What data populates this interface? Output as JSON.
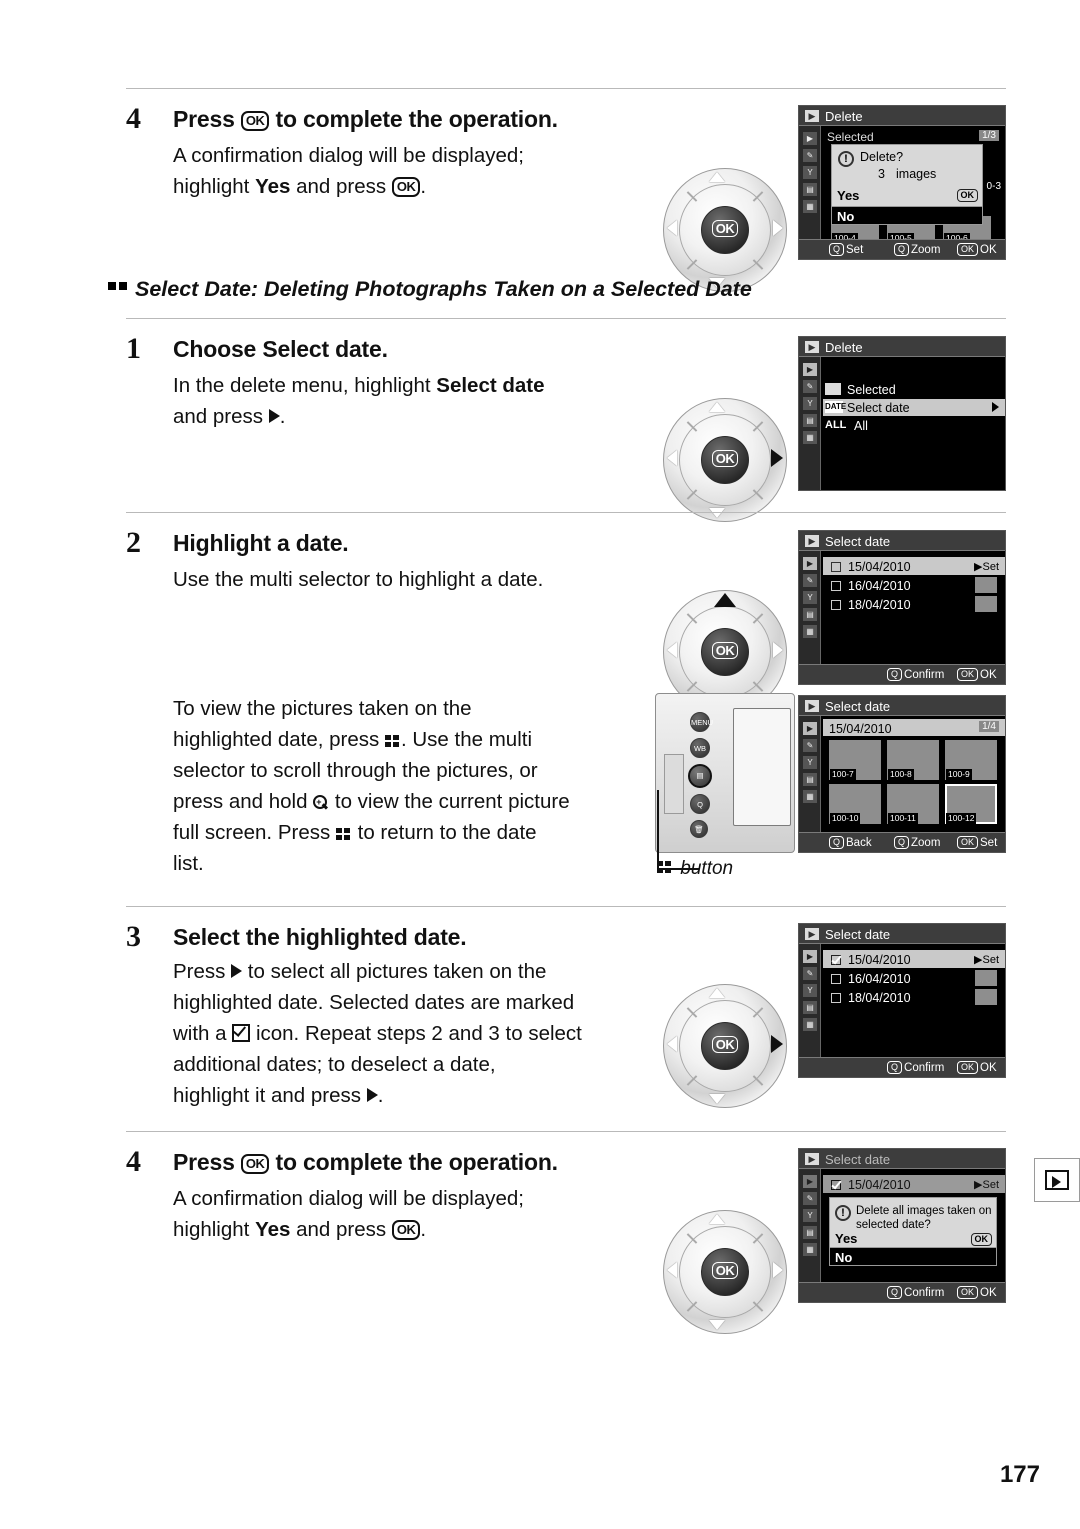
{
  "page": {
    "number": "177"
  },
  "section": {
    "heading": "Select Date: Deleting Photographs Taken on a Selected Date"
  },
  "steps": [
    {
      "num": "4",
      "title_pre": "Press ",
      "title_post": " to complete the operation.",
      "body_l1": "A confirmation dialog will be displayed;",
      "body_l2_pre": "highlight ",
      "body_l2_bold": "Yes",
      "body_l2_post": " and press "
    },
    {
      "num": "1",
      "title_pre": "Choose ",
      "title_bold": "Select date",
      "title_post": ".",
      "body_l1_pre": "In the delete menu, highlight ",
      "body_l1_bold": "Select date",
      "body_l2": "and press"
    },
    {
      "num": "2",
      "title": "Highlight a date.",
      "body": "Use the multi selector to highlight a date.",
      "para2": [
        "To view the pictures taken on the",
        "highlighted date, press      .  Use the multi",
        "selector to scroll through the pictures, or",
        "press and hold      to view the current picture",
        "full screen.  Press      to return to the date",
        "list."
      ]
    },
    {
      "num": "3",
      "title": "Select the highlighted date.",
      "para": [
        "Press      to select all pictures taken on the",
        "highlighted date.  Selected dates are marked",
        "with a      icon.  Repeat steps 2 and 3 to select",
        "additional dates; to deselect a date,",
        "highlight it and press      ."
      ]
    },
    {
      "num": "4",
      "title_pre": "Press ",
      "title_post": " to complete the operation.",
      "body_l1": "A confirmation dialog will be displayed;",
      "body_l2_pre": "highlight ",
      "body_l2_bold": "Yes",
      "body_l2_post": " and press "
    }
  ],
  "caption": {
    "button_label": "button"
  },
  "lcd1": {
    "title": "Delete",
    "subtitle": "Selected",
    "corner": "1/3",
    "dialog_q": "Delete?",
    "dialog_count": "3",
    "dialog_unit": "images",
    "yes": "Yes",
    "no": "No",
    "ok_badge": "OK",
    "thumbs": [
      "100-4",
      "100-5",
      "100-6"
    ],
    "side_num": "0-3",
    "bottom": [
      {
        "key": "Q",
        "label": "Set"
      },
      {
        "key": "Q",
        "label": "Zoom"
      },
      {
        "key": "OK",
        "label": "OK"
      }
    ]
  },
  "lcd2": {
    "title": "Delete",
    "items": [
      {
        "icon": "thumbnails",
        "label": "Selected",
        "selected": false
      },
      {
        "icon": "DATE",
        "label": "Select date",
        "selected": true
      },
      {
        "icon": "ALL",
        "label": "All",
        "selected": false
      }
    ]
  },
  "lcd3": {
    "title": "Select date",
    "rows": [
      {
        "date": "15/04/2010",
        "checked": false,
        "highlight": true
      },
      {
        "date": "16/04/2010",
        "checked": false,
        "highlight": false
      },
      {
        "date": "18/04/2010",
        "checked": false,
        "highlight": false
      }
    ],
    "set_label": "Set",
    "bottom": [
      {
        "key": "Q",
        "label": "Confirm"
      },
      {
        "key": "OK",
        "label": "OK"
      }
    ]
  },
  "lcd4": {
    "title": "Select date",
    "header_date": "15/04/2010",
    "corner": "1/4",
    "thumbs": [
      "100-7",
      "100-8",
      "100-9",
      "100-10",
      "100-11",
      "100-12"
    ],
    "bottom": [
      {
        "key": "Q",
        "label": "Back"
      },
      {
        "key": "Q",
        "label": "Zoom"
      },
      {
        "key": "OK",
        "label": "Set"
      }
    ]
  },
  "lcd5": {
    "title": "Select date",
    "rows": [
      {
        "date": "15/04/2010",
        "checked": true,
        "highlight": true
      },
      {
        "date": "16/04/2010",
        "checked": false,
        "highlight": false
      },
      {
        "date": "18/04/2010",
        "checked": false,
        "highlight": false
      }
    ],
    "set_label": "Set",
    "bottom": [
      {
        "key": "Q",
        "label": "Confirm"
      },
      {
        "key": "OK",
        "label": "OK"
      }
    ]
  },
  "lcd6": {
    "title": "Select date",
    "row_date": "15/04/2010",
    "set_label": "Set",
    "dialog_l1": "Delete all images taken on",
    "dialog_l2": "selected date?",
    "yes": "Yes",
    "no": "No",
    "ok_badge": "OK",
    "bottom": [
      {
        "key": "Q",
        "label": "Confirm"
      },
      {
        "key": "OK",
        "label": "OK"
      }
    ]
  },
  "colors": {
    "page_bg": "#ffffff",
    "text": "#111111",
    "rule": "#b9b9b9",
    "lcd_bg": "#000000",
    "lcd_bar": "#3d3d3d",
    "highlight": "#c9c9c9"
  }
}
